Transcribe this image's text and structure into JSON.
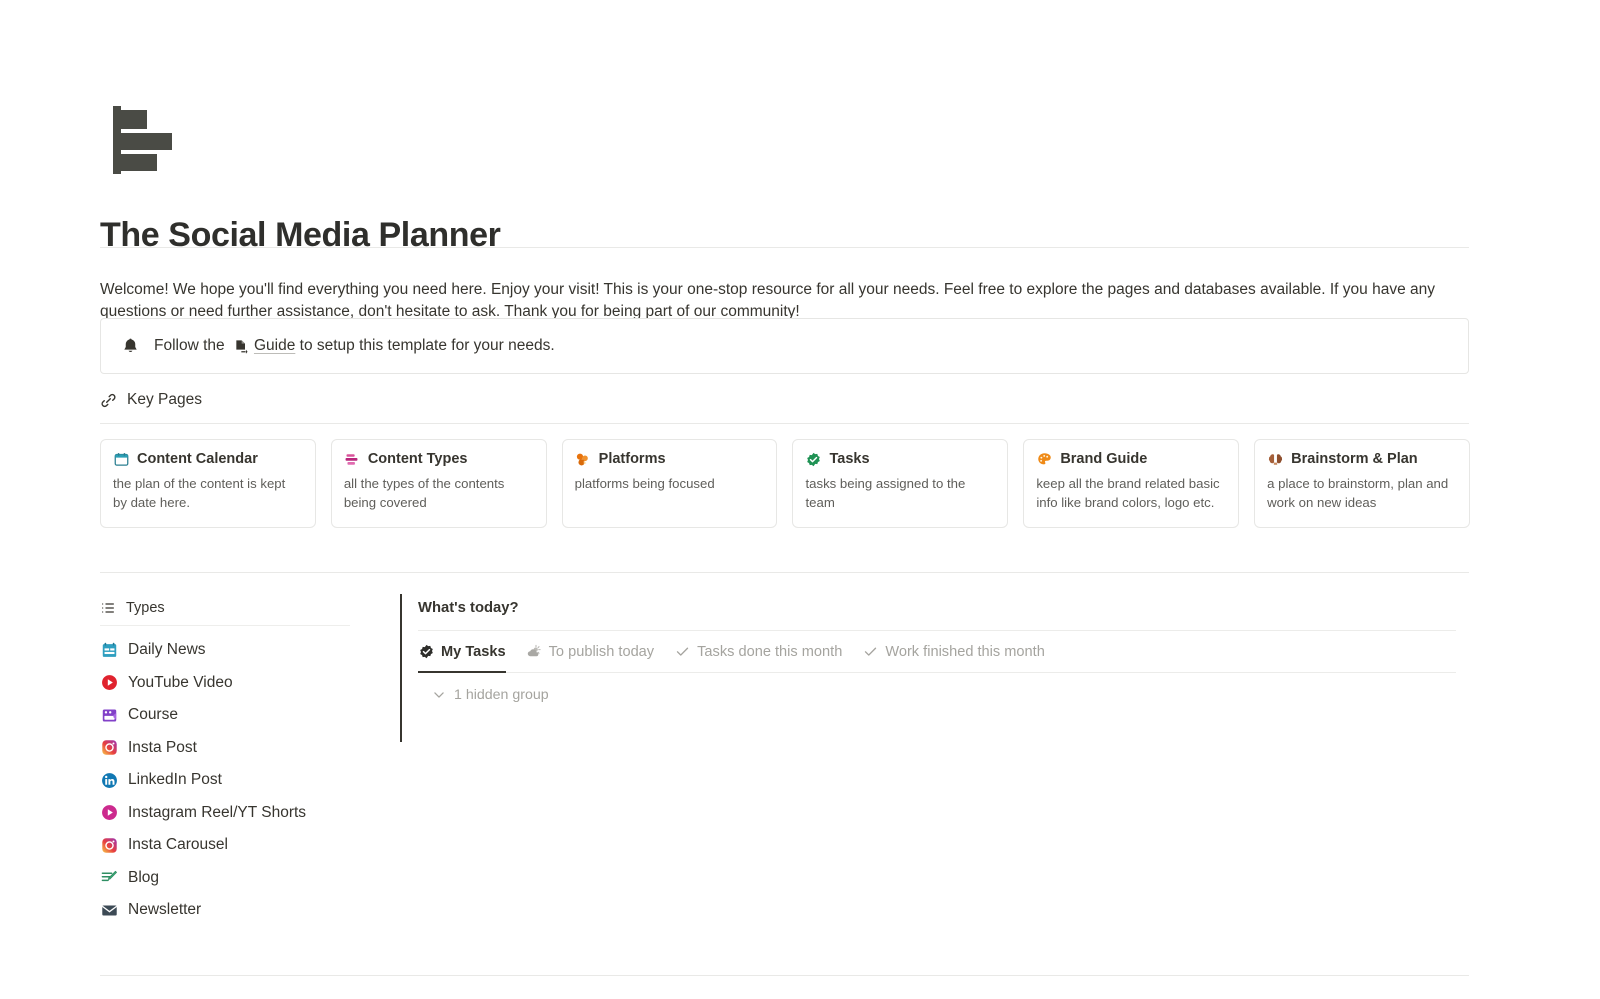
{
  "header": {
    "icon_name": "bar-chart-icon",
    "title": "The Social Media Planner"
  },
  "intro": {
    "text": "Welcome! We hope you'll find everything you need here. Enjoy your visit! This is your one-stop resource for all your needs. Feel free to explore the pages and databases available. If you have any questions or need further assistance, don't hesitate to ask. Thank you for being part of our community!"
  },
  "callout": {
    "icon_name": "bell-icon",
    "text_before": "Follow the ",
    "link_icon_name": "page-link-icon",
    "link_label": "Guide",
    "text_after": " to setup this template for your needs."
  },
  "key_pages": {
    "icon_name": "link-icon",
    "label": "Key Pages",
    "cards": [
      {
        "emoji": "🗓️",
        "icon_name": "calendar-emoji",
        "title": "Content Calendar",
        "description": "the plan of the content is kept by date here."
      },
      {
        "emoji": "🗂️",
        "icon_name": "card-index-dividers-emoji",
        "title": "Content Types",
        "description": "all the types of the contents being covered"
      },
      {
        "emoji": "🧩",
        "icon_name": "puzzle-emoji",
        "title": "Platforms",
        "description": "platforms being focused"
      },
      {
        "emoji": "✅",
        "icon_name": "check-badge-emoji",
        "title": "Tasks",
        "description": "tasks being assigned to the team"
      },
      {
        "emoji": "🎨",
        "icon_name": "palette-emoji",
        "title": "Brand Guide",
        "description": "keep all the brand related basic info like brand colors, logo etc."
      },
      {
        "emoji": "🧠",
        "icon_name": "brain-emoji",
        "title": "Brainstorm & Plan",
        "description": "a place to brainstorm, plan and work on new ideas"
      }
    ]
  },
  "types": {
    "icon_name": "bulleted-list-icon",
    "header": "Types",
    "items": [
      {
        "label": "Daily News",
        "icon_name": "calendar-news-emoji"
      },
      {
        "label": "YouTube Video",
        "icon_name": "youtube-play-emoji"
      },
      {
        "label": "Course",
        "icon_name": "film-projector-emoji"
      },
      {
        "label": "Insta Post",
        "icon_name": "instagram-emoji"
      },
      {
        "label": "LinkedIn Post",
        "icon_name": "linkedin-emoji"
      },
      {
        "label": "Instagram Reel/YT Shorts",
        "icon_name": "reel-play-emoji"
      },
      {
        "label": "Insta Carousel",
        "icon_name": "instagram-emoji"
      },
      {
        "label": "Blog",
        "icon_name": "memo-pencil-emoji"
      },
      {
        "label": "Newsletter",
        "icon_name": "envelope-emoji"
      }
    ]
  },
  "today": {
    "title": "What's today?",
    "tabs": [
      {
        "label": "My Tasks",
        "icon_name": "check-badge-emoji",
        "active": true
      },
      {
        "label": "To publish today",
        "icon_name": "sun-behind-cloud-emoji",
        "active": false
      },
      {
        "label": "Tasks done this month",
        "icon_name": "check-icon",
        "active": false
      },
      {
        "label": "Work finished this month",
        "icon_name": "check-icon",
        "active": false
      }
    ],
    "hidden_group_label": "1 hidden group"
  },
  "colors": {
    "text": "#37352f",
    "muted": "#a5a49f",
    "divider": "#e9e9e7",
    "card_border": "#e7e7e5",
    "icon_dark": "#4a4b45"
  }
}
